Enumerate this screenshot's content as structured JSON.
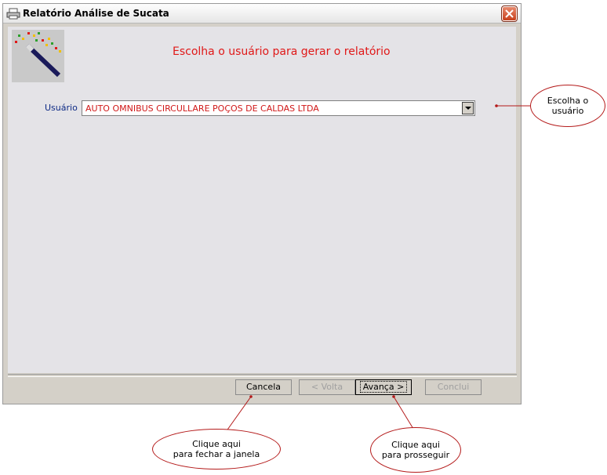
{
  "window": {
    "title": "Relatório Análise de Sucata"
  },
  "content": {
    "heading": "Escolha o usuário para gerar o relatório",
    "user_label": "Usuário",
    "user_value": "AUTO OMNIBUS CIRCULLARE POÇOS DE CALDAS LTDA"
  },
  "buttons": {
    "cancel": "Cancela",
    "back": "< Volta",
    "next": "Avança >",
    "finish": "Conclui"
  },
  "annotations": {
    "choose_user": [
      "Escolha o",
      "usuário"
    ],
    "close_hint": [
      "Clique aqui",
      "para fechar a janela"
    ],
    "next_hint": [
      "Clique aqui",
      "para prosseguir"
    ]
  },
  "colors": {
    "heading": "#e01818",
    "label": "#0d2a85",
    "callout_border": "#b41a1a"
  }
}
